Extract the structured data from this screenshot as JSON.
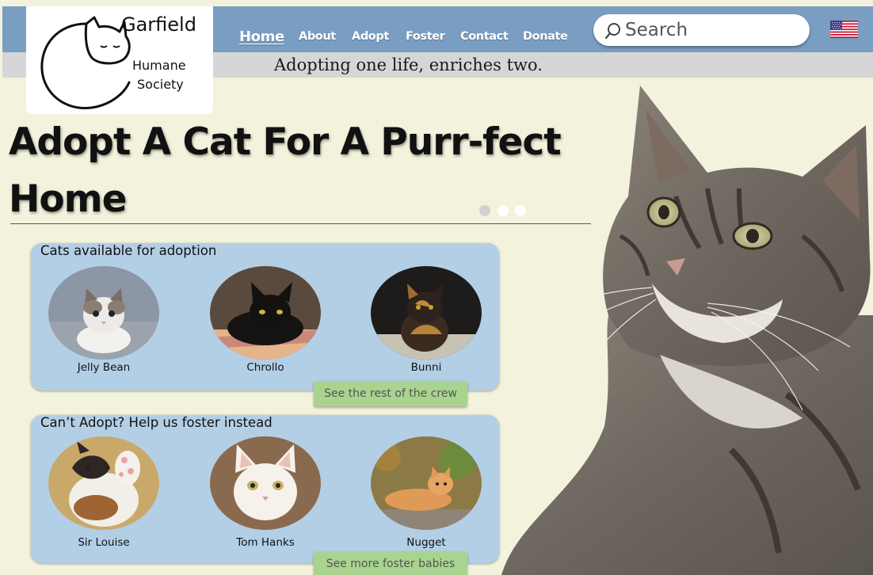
{
  "logo": {
    "name": "Garfield",
    "sub_line1": "Humane",
    "sub_line2": "Society",
    "icon": "sleeping-cat-logo"
  },
  "nav": {
    "items": [
      {
        "label": "Home",
        "active": true
      },
      {
        "label": "About"
      },
      {
        "label": "Adopt"
      },
      {
        "label": "Foster"
      },
      {
        "label": "Contact"
      },
      {
        "label": "Donate"
      }
    ]
  },
  "search": {
    "placeholder": "Search",
    "icon": "search-icon"
  },
  "language": {
    "icon": "us-flag-icon"
  },
  "tagline": "Adopting one life, enriches two.",
  "hero": {
    "title": "Adopt A Cat For A Purr-fect Home",
    "carousel_dots": 3,
    "active_dot": 1
  },
  "adopt_section": {
    "title": "Cats available for adoption",
    "cats": [
      {
        "name": "Jelly Bean"
      },
      {
        "name": "Chrollo"
      },
      {
        "name": "Bunni"
      }
    ],
    "button_label": "See the rest of the crew"
  },
  "foster_section": {
    "title": "Can’t Adopt? Help us foster instead",
    "cats": [
      {
        "name": "Sir Louise"
      },
      {
        "name": "Tom Hanks"
      },
      {
        "name": "Nugget"
      }
    ],
    "button_label": "See more foster babies"
  },
  "colors": {
    "topbar": "#7a9dc2",
    "tagline_bar": "#d6d6d6",
    "background": "#f3f2dd",
    "panel": "#b3cfe6",
    "button": "#a9d48f"
  }
}
